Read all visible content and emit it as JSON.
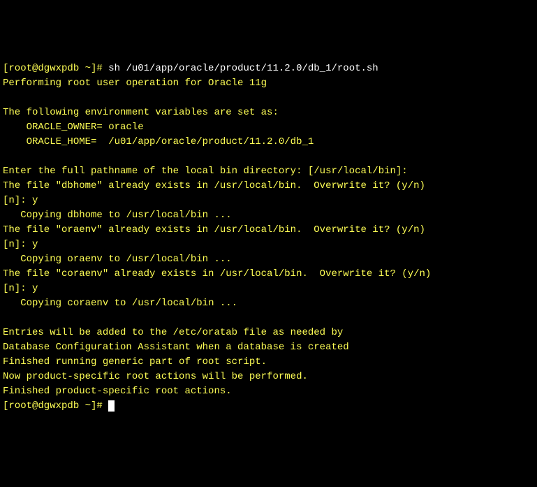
{
  "terminal": {
    "prompt1": {
      "full": "[root@dgwxpdb ~]# ",
      "command": "sh /u01/app/oracle/product/11.2.0/db_1/root.sh"
    },
    "lines": [
      "Performing root user operation for Oracle 11g",
      "",
      "The following environment variables are set as:",
      "    ORACLE_OWNER= oracle",
      "    ORACLE_HOME=  /u01/app/oracle/product/11.2.0/db_1",
      "",
      "Enter the full pathname of the local bin directory: [/usr/local/bin]:",
      "The file \"dbhome\" already exists in /usr/local/bin.  Overwrite it? (y/n)",
      "[n]: y",
      "   Copying dbhome to /usr/local/bin ...",
      "The file \"oraenv\" already exists in /usr/local/bin.  Overwrite it? (y/n)",
      "[n]: y",
      "   Copying oraenv to /usr/local/bin ...",
      "The file \"coraenv\" already exists in /usr/local/bin.  Overwrite it? (y/n)",
      "[n]: y",
      "   Copying coraenv to /usr/local/bin ...",
      "",
      "Entries will be added to the /etc/oratab file as needed by",
      "Database Configuration Assistant when a database is created",
      "Finished running generic part of root script.",
      "Now product-specific root actions will be performed.",
      "Finished product-specific root actions."
    ],
    "prompt2": {
      "full": "[root@dgwxpdb ~]# "
    }
  }
}
